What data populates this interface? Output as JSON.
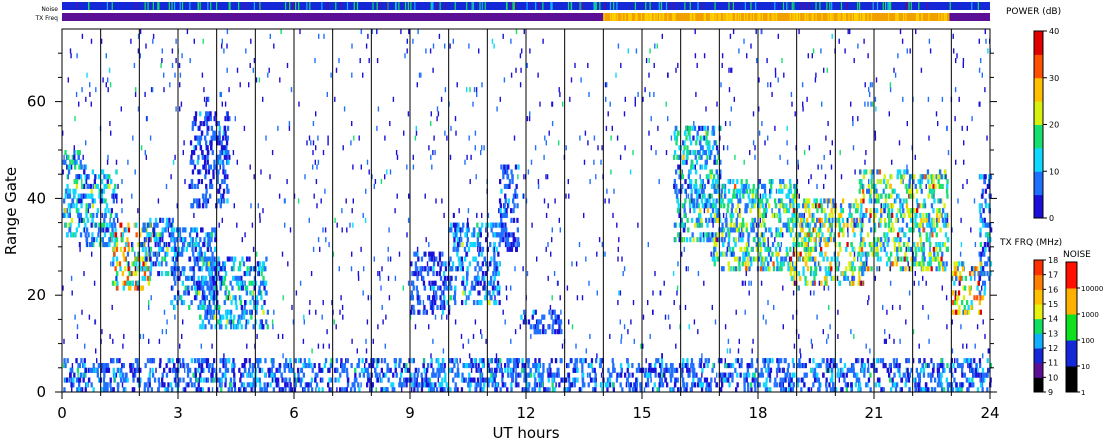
{
  "chart_data": {
    "type": "heatmap",
    "title": "",
    "xlabel": "UT hours",
    "ylabel": "Range Gate",
    "xlim": [
      0,
      24
    ],
    "ylim": [
      0,
      75
    ],
    "x_ticks": [
      "0",
      "3",
      "6",
      "9",
      "12",
      "15",
      "18",
      "21",
      "24"
    ],
    "y_ticks": [
      "0",
      "20",
      "40",
      "60"
    ],
    "grid": "vertical lines every hour",
    "status_bars": [
      {
        "name": "Noise",
        "label": "Noise",
        "dominant_color": "#1428d8"
      },
      {
        "name": "TX Freq",
        "label": "TX Freq",
        "segments": [
          {
            "from": 0,
            "to": 14.0,
            "color": "#5a0f94"
          },
          {
            "from": 14.0,
            "to": 22.95,
            "color": "#f0a000"
          },
          {
            "from": 22.95,
            "to": 24,
            "color": "#5a0f94"
          }
        ]
      }
    ],
    "power_scale": {
      "title": "POWER (dB)",
      "ticks": [
        "0",
        "10",
        "20",
        "30",
        "40"
      ],
      "range": [
        0,
        40
      ],
      "colors": [
        "#1a10d8",
        "#2070ff",
        "#10d8ff",
        "#18e070",
        "#d8f010",
        "#ffc000",
        "#ff5000",
        "#e00000"
      ]
    },
    "txfreq_scale": {
      "title": "TX FRQ (MHz)",
      "ticks": [
        "9",
        "10",
        "11",
        "12",
        "13",
        "14",
        "15",
        "16",
        "17",
        "18"
      ],
      "colors": [
        "#000000",
        "#5a0f94",
        "#1428d8",
        "#10b0ff",
        "#10e060",
        "#e8f010",
        "#ffc000",
        "#ff8000",
        "#ff3000"
      ]
    },
    "noise_scale": {
      "title": "NOISE",
      "ticks": [
        "1",
        "10",
        "100",
        "1000",
        "10000"
      ],
      "colors": [
        "#000000",
        "#1428d8",
        "#10e020",
        "#ffb000",
        "#ff1000"
      ]
    },
    "echo_regions": [
      {
        "t0": 0.0,
        "t1": 0.6,
        "g0": 32,
        "g1": 50,
        "peak": 16
      },
      {
        "t0": 0.6,
        "t1": 1.4,
        "g0": 30,
        "g1": 46,
        "peak": 14
      },
      {
        "t0": 1.2,
        "t1": 2.3,
        "g0": 21,
        "g1": 35,
        "peak": 30
      },
      {
        "t0": 2.0,
        "t1": 2.9,
        "g0": 24,
        "g1": 36,
        "peak": 14
      },
      {
        "t0": 2.8,
        "t1": 4.0,
        "g0": 17,
        "g1": 34,
        "peak": 10
      },
      {
        "t0": 3.5,
        "t1": 5.3,
        "g0": 13,
        "g1": 28,
        "peak": 14
      },
      {
        "t0": 3.3,
        "t1": 4.3,
        "g0": 38,
        "g1": 58,
        "peak": 8
      },
      {
        "t0": 9.0,
        "t1": 10.0,
        "g0": 16,
        "g1": 29,
        "peak": 8
      },
      {
        "t0": 10.0,
        "t1": 11.3,
        "g0": 18,
        "g1": 35,
        "peak": 12
      },
      {
        "t0": 11.3,
        "t1": 11.8,
        "g0": 29,
        "g1": 47,
        "peak": 8
      },
      {
        "t0": 11.8,
        "t1": 12.9,
        "g0": 12,
        "g1": 17,
        "peak": 8
      },
      {
        "t0": 15.8,
        "t1": 17.0,
        "g0": 31,
        "g1": 55,
        "peak": 16
      },
      {
        "t0": 16.8,
        "t1": 19.0,
        "g0": 25,
        "g1": 44,
        "peak": 20
      },
      {
        "t0": 18.8,
        "t1": 20.7,
        "g0": 22,
        "g1": 40,
        "peak": 26
      },
      {
        "t0": 20.6,
        "t1": 22.9,
        "g0": 25,
        "g1": 46,
        "peak": 22
      },
      {
        "t0": 23.0,
        "t1": 23.8,
        "g0": 16,
        "g1": 27,
        "peak": 30
      },
      {
        "t0": 23.7,
        "t1": 24.0,
        "g0": 20,
        "g1": 45,
        "peak": 12
      },
      {
        "t0": 0.0,
        "t1": 24.0,
        "g0": 0,
        "g1": 7,
        "peak": 10
      }
    ]
  }
}
